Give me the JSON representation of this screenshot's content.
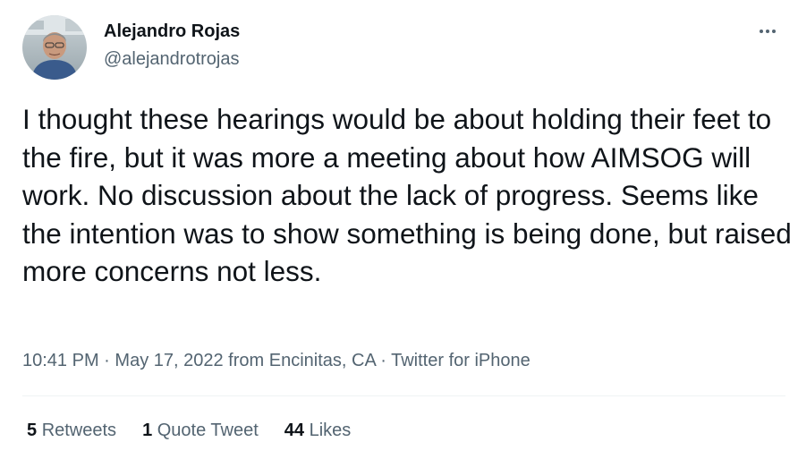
{
  "author": {
    "display_name": "Alejandro Rojas",
    "handle": "@alejandrotrojas",
    "avatar_icon": "profile-photo"
  },
  "tweet": {
    "text": "I thought these hearings would be about holding their feet to the fire, but it was more a meeting about how AIMSOG will work. No discussion about the lack of progress. Seems like the intention was to show something is being done, but raised more concerns not less.",
    "time": "10:41 PM",
    "separator": "·",
    "date": "May 17, 2022",
    "location_prefix": "from",
    "location": "Encinitas, CA",
    "source": "Twitter for iPhone"
  },
  "stats": {
    "retweets": {
      "count": "5",
      "label": "Retweets"
    },
    "quote_tweets": {
      "count": "1",
      "label": "Quote Tweet"
    },
    "likes": {
      "count": "44",
      "label": "Likes"
    }
  },
  "more_icon": "more-horizontal-icon",
  "colors": {
    "text_primary": "#0f1419",
    "text_secondary": "#536471",
    "divider": "#eff3f4",
    "background": "#ffffff"
  }
}
